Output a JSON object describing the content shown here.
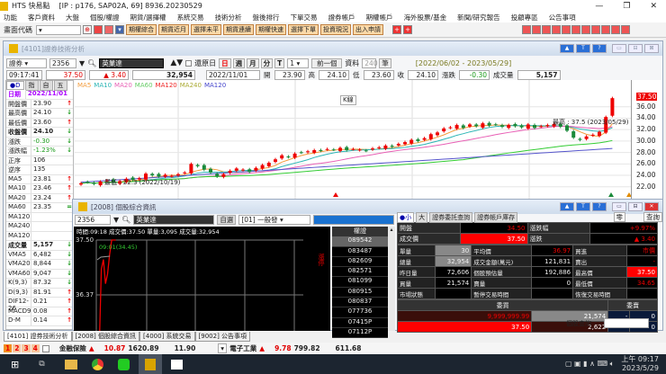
{
  "app": {
    "title": "HTS 快易點",
    "info": "[IP : p176, SAP02A, 69] 8936.20230529"
  },
  "menu": [
    "功能",
    "客戶資料",
    "大盤",
    "個股/權證",
    "期貨/選擇權",
    "系統交易",
    "技術分析",
    "盤後排行",
    "下單交易",
    "證券帳戶",
    "期權帳戶",
    "海外股票/基金",
    "新聞/研究報告",
    "投顧專區",
    "公告事項"
  ],
  "toolbar": {
    "code_label": "畫面代碼",
    "buttons": [
      "期權綜合",
      "期貨近月",
      "選擇未平",
      "期貨連續",
      "期權快速",
      "選擇下單",
      "投資現況",
      "出入申請"
    ]
  },
  "win4101": {
    "title": "[4101]證券技術分析",
    "market": "證券",
    "code": "2356",
    "name": "英業達",
    "adjust_label": "還原日",
    "periods": [
      "日",
      "週",
      "月",
      "分",
      "T"
    ],
    "period_select": "1",
    "prev": "前一個",
    "data_label": "資料",
    "data_count": "240",
    "data_unit": "筆",
    "range": "[2022/06/02 - 2023/05/29]",
    "quote": {
      "time": "09:17:41",
      "price": "37.50",
      "change": "▲ 3.40",
      "volume": "32,954",
      "date": "2022/11/01",
      "open_l": "開",
      "open": "23.90",
      "high_l": "高",
      "high": "24.10",
      "low_l": "低",
      "low": "23.60",
      "close_l": "收",
      "close": "24.10",
      "chg_l": "漲跌",
      "chg": "-0.30",
      "vol_l": "成交量",
      "vol": "5,157"
    },
    "tabs": [
      "●D",
      "指",
      "自",
      "五"
    ],
    "rows": [
      [
        "日期",
        "2022/11/01",
        ""
      ],
      [
        "開盤價",
        "23.90",
        "up"
      ],
      [
        "最高價",
        "24.10",
        "down"
      ],
      [
        "最低價",
        "23.60",
        "up"
      ],
      [
        "收盤價",
        "24.10",
        "down"
      ],
      [
        "漲跌",
        "-0.30",
        "down"
      ],
      [
        "漲跌幅",
        "-1.23%",
        "down"
      ],
      [
        "正序",
        "106",
        ""
      ],
      [
        "逆序",
        "135",
        ""
      ],
      [
        "MA5",
        "23.81",
        "up"
      ],
      [
        "MA10",
        "23.46",
        "up"
      ],
      [
        "MA20",
        "23.24",
        "up"
      ],
      [
        "MA60",
        "23.35",
        "eq"
      ],
      [
        "MA120",
        "",
        ""
      ],
      [
        "MA240",
        "",
        ""
      ],
      [
        "MA120",
        "",
        ""
      ],
      [
        "成交量",
        "5,157",
        "down"
      ],
      [
        "VMA5",
        "6,482",
        "down"
      ],
      [
        "VMA20",
        "8,844",
        "down"
      ],
      [
        "VMA60",
        "9,047",
        "down"
      ],
      [
        "K(9,3)",
        "87.32",
        "down"
      ],
      [
        "D(9,3)",
        "81.91",
        "up"
      ],
      [
        "DIF12-26",
        "0.21",
        "up"
      ],
      [
        "MACD9",
        "0.08",
        "up"
      ],
      [
        "D-M",
        "0.14",
        "up"
      ]
    ],
    "legend": [
      "MA5",
      "MA10",
      "MA20",
      "MA60",
      "MA120",
      "MA240",
      "MA120"
    ],
    "kline": "K線",
    "high_note": "最高 : 37.5 (2023/05/29)",
    "low_note": "最低 : 22.3 (2022/10/19)",
    "last_tag": "37.50"
  },
  "chart_data": [
    {
      "type": "candlestick",
      "title": "英業達 2356 日K",
      "ylim": [
        22,
        38
      ],
      "yticks": [
        22,
        24,
        26,
        28,
        30,
        32,
        34,
        36
      ],
      "closes": [
        22.6,
        22.8,
        22.5,
        22.9,
        23.1,
        22.7,
        23.0,
        23.4,
        23.2,
        23.5,
        24.3,
        24.0,
        23.8,
        24.1,
        23.9,
        24.2,
        24.5,
        26.0,
        25.6,
        25.0,
        24.5,
        23.8,
        24.2,
        24.8,
        25.2,
        25.0,
        24.6,
        25.3,
        25.8,
        26.2,
        26.8,
        27.5,
        27.2,
        27.8,
        28.0,
        28.2,
        28.4,
        28.3,
        28.6,
        28.5,
        28.8,
        28.4,
        28.6,
        28.5,
        28.3,
        28.7,
        28.9,
        29.2,
        29.0,
        29.5,
        29.8,
        30.2,
        30.0,
        30.5,
        31.2,
        31.5,
        32.2,
        32.4,
        32.8,
        32.3,
        32.9,
        32.6,
        33.1,
        32.7,
        32.9,
        32.5,
        32.8,
        32.6,
        32.4,
        32.9,
        32.3,
        32.6,
        32.8,
        33.0,
        32.5,
        31.8,
        30.6,
        30.2,
        30.8,
        31.1,
        31.6,
        34.2,
        37.5
      ]
    },
    {
      "type": "line",
      "title": "intraday",
      "ylim": [
        35.2,
        37.5
      ],
      "values": [
        34.6,
        35.3,
        36.9,
        37.1,
        36.6,
        36.8,
        37.2,
        37.5,
        37.5,
        37.5
      ],
      "ytick_labels": [
        "37.50",
        "36.37"
      ],
      "note": "09:01(34.45)",
      "limit": "漲停"
    }
  ],
  "win2008": {
    "title": "[2008] 個股綜合資訊",
    "code": "2356",
    "name": "英業達",
    "self_label": "自選",
    "group": "[01] 一般發",
    "header": "時間:09:18 成交價:37.50 單量:3,095 成交量:32,954",
    "broker_head": "權證",
    "brokers": [
      "089542",
      "083487",
      "082609",
      "082571",
      "081099",
      "080915",
      "080837",
      "077736",
      "07415P",
      "07112P"
    ],
    "tabs": [
      "●小",
      "大",
      "證券委託查詢",
      "證券帳戶庫存"
    ],
    "zero": "零",
    "query": "查詢",
    "grid": [
      [
        "開盤",
        "34.50",
        "漲跌幅",
        "+9.97%"
      ],
      [
        "成交價",
        "37.50",
        "漲跌",
        "▲ 3.40"
      ]
    ],
    "grid3": [
      [
        "單量",
        "30",
        "平均價",
        "36.97",
        "買進",
        "市價"
      ],
      [
        "總量",
        "32,954",
        "成交金額(萬元)",
        "121,831",
        "賣出",
        "-"
      ],
      [
        "昨日量",
        "72,606",
        "個股預估量",
        "192,886",
        "最高價",
        "37.50"
      ],
      [
        "買量",
        "21,574",
        "賣量",
        "0",
        "最低價",
        "34.65"
      ],
      [
        "市場狀態",
        "",
        "暫停交易時間",
        "",
        "恢復交易時間",
        ""
      ]
    ],
    "book_head": [
      "委買",
      "委賣"
    ],
    "book": [
      [
        "9,999,999.99",
        "21,574",
        "-",
        "0"
      ],
      [
        "37.50",
        "2,622",
        "-",
        "0"
      ]
    ],
    "stock_query": "個股查詢"
  },
  "bottom_tabs": [
    "[4101] 證券技術分析",
    "[2008] 個股綜合資訊",
    "[4000] 系統交易",
    "[9002] 公告事項"
  ],
  "ticker": {
    "pages": [
      "1",
      "2",
      "3",
      "4"
    ],
    "a_name": "金融保險",
    "a_chg": "10.87",
    "a_idx": "1620.89",
    "a_val": "11.90",
    "b_name": "電子工業",
    "b_chg": "9.78",
    "b_idx": "799.82",
    "b_val": "611.68"
  },
  "clock": {
    "time": "上午 09:17",
    "date": "2023/5/29"
  },
  "colors": {
    "up": "#e00000",
    "down": "#1a9a1a",
    "accent": "#0a64d8"
  }
}
